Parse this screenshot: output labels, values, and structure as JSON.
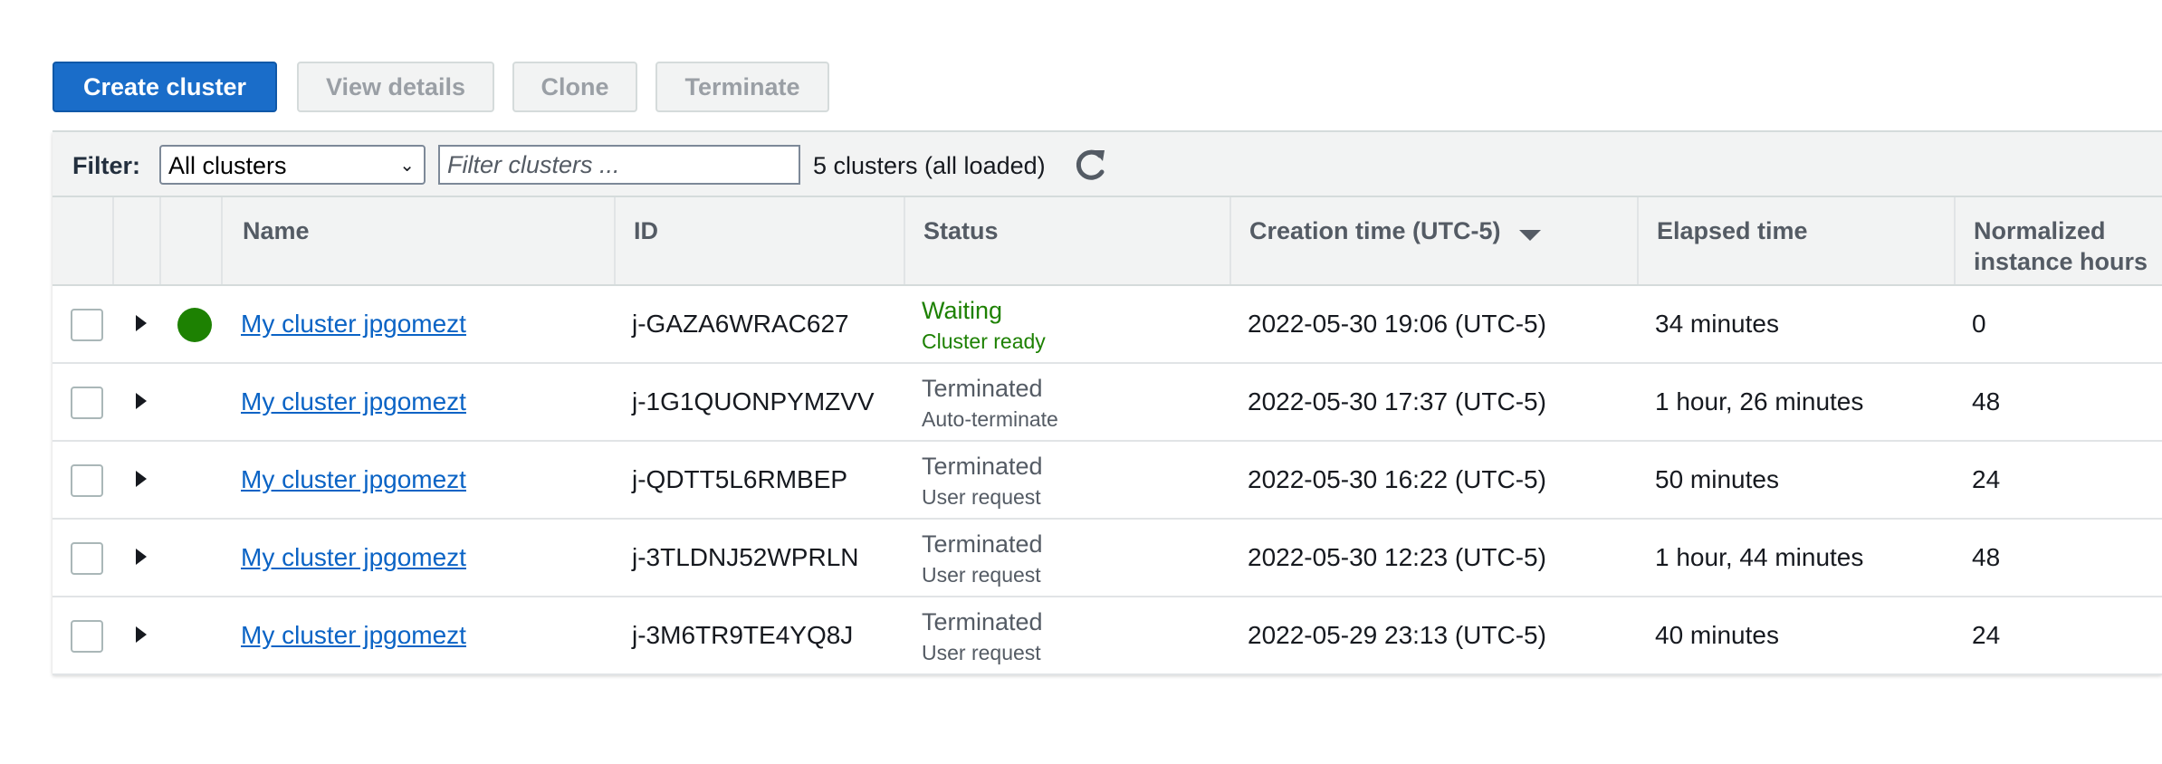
{
  "toolbar": {
    "create_label": "Create cluster",
    "view_label": "View details",
    "clone_label": "Clone",
    "terminate_label": "Terminate"
  },
  "filter": {
    "label": "Filter:",
    "selected": "All clusters",
    "placeholder": "Filter clusters ...",
    "count_text": "5 clusters (all loaded)"
  },
  "columns": {
    "name": "Name",
    "id": "ID",
    "status": "Status",
    "creation": "Creation time (UTC-5)",
    "elapsed": "Elapsed time",
    "hours_line1": "Normalized",
    "hours_line2": "instance hours"
  },
  "colors": {
    "primary": "#1a6dc9",
    "waiting": "#1d8102",
    "terminated": "#545b64",
    "link": "#0a63c5"
  },
  "rows": [
    {
      "name": "My cluster jpgomezt",
      "id": "j-GAZA6WRAC627",
      "status": "Waiting",
      "status_detail": "Cluster ready",
      "state": "waiting",
      "created": "2022-05-30 19:06 (UTC-5)",
      "elapsed": "34 minutes",
      "hours": "0"
    },
    {
      "name": "My cluster jpgomezt",
      "id": "j-1G1QUONPYMZVV",
      "status": "Terminated",
      "status_detail": "Auto-terminate",
      "state": "terminated",
      "created": "2022-05-30 17:37 (UTC-5)",
      "elapsed": "1 hour, 26 minutes",
      "hours": "48"
    },
    {
      "name": "My cluster jpgomezt",
      "id": "j-QDTT5L6RMBEP",
      "status": "Terminated",
      "status_detail": "User request",
      "state": "terminated",
      "created": "2022-05-30 16:22 (UTC-5)",
      "elapsed": "50 minutes",
      "hours": "24"
    },
    {
      "name": "My cluster jpgomezt",
      "id": "j-3TLDNJ52WPRLN",
      "status": "Terminated",
      "status_detail": "User request",
      "state": "terminated",
      "created": "2022-05-30 12:23 (UTC-5)",
      "elapsed": "1 hour, 44 minutes",
      "hours": "48"
    },
    {
      "name": "My cluster jpgomezt",
      "id": "j-3M6TR9TE4YQ8J",
      "status": "Terminated",
      "status_detail": "User request",
      "state": "terminated",
      "created": "2022-05-29 23:13 (UTC-5)",
      "elapsed": "40 minutes",
      "hours": "24"
    }
  ]
}
